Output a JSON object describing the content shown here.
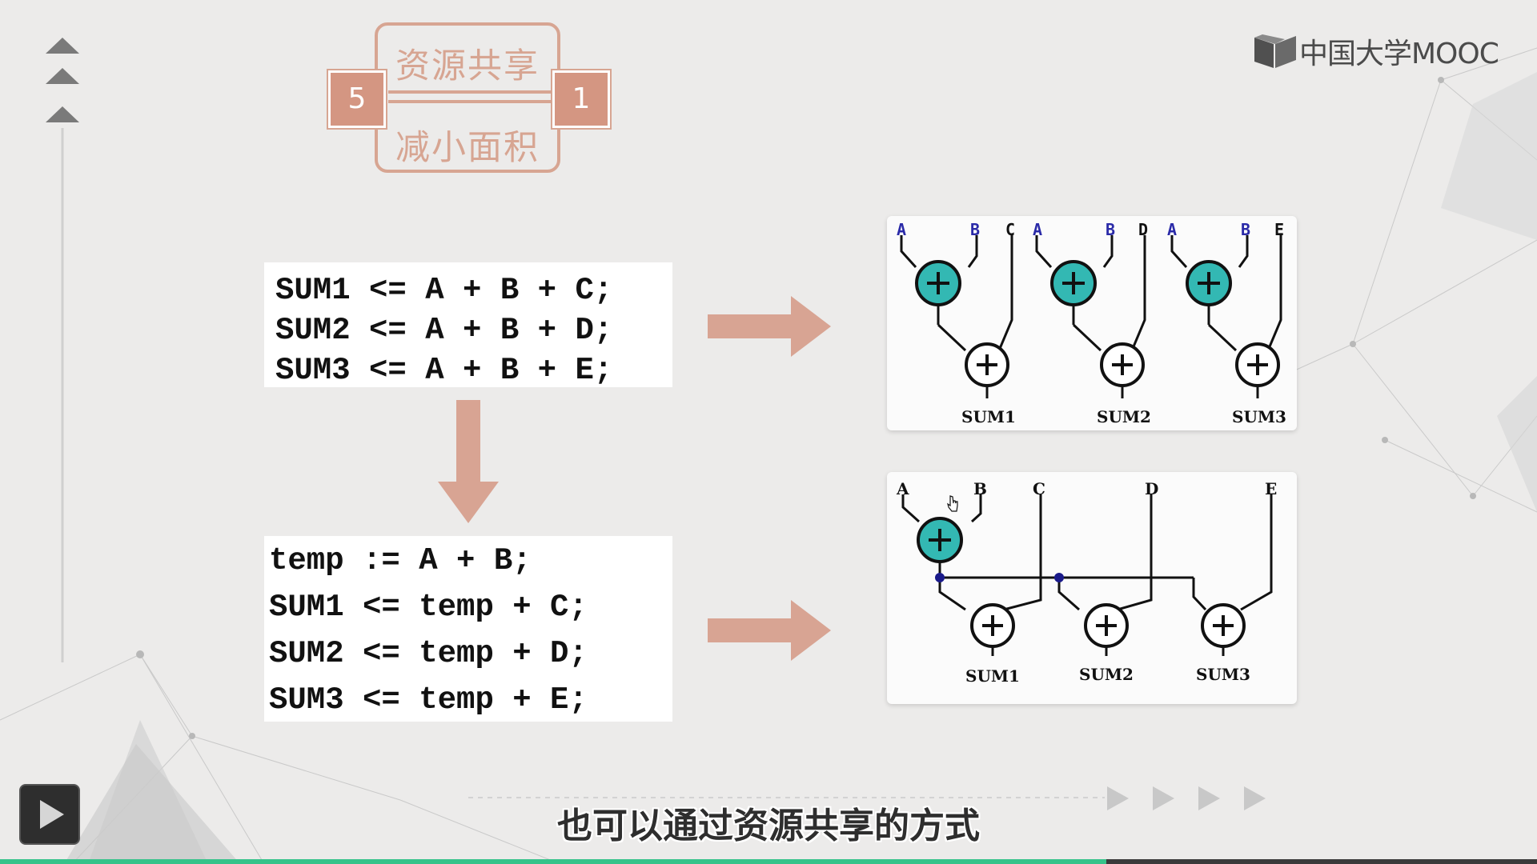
{
  "slide": {
    "title_top": "资源共享",
    "title_bottom": "减小面积",
    "badge_left": "5",
    "badge_right": "1"
  },
  "code_before": {
    "lines": [
      "SUM1 <= A + B + C;",
      "SUM2 <= A + B + D;",
      "SUM3 <= A + B + E;"
    ]
  },
  "code_after": {
    "lines": [
      "temp := A + B;",
      "SUM1 <= temp + C;",
      "SUM2 <= temp + D;",
      "SUM3 <= temp + E;"
    ]
  },
  "circuit_before": {
    "inputs": [
      "A",
      "B",
      "C",
      "A",
      "B",
      "D",
      "A",
      "B",
      "E"
    ],
    "outputs": [
      "SUM1",
      "SUM2",
      "SUM3"
    ]
  },
  "circuit_after": {
    "inputs": [
      "A",
      "B",
      "C",
      "D",
      "E"
    ],
    "outputs": [
      "SUM1",
      "SUM2",
      "SUM3"
    ]
  },
  "logo": {
    "text": "中国大学MOOC",
    "icon": "book-icon"
  },
  "subtitle": "也可以通过资源共享的方式",
  "player": {
    "progress": 0.72,
    "play_icon": "play-icon"
  },
  "colors": {
    "accent": "#d49682",
    "arrow": "#d8a493",
    "adder_highlight": "#33b8b3",
    "progress": "#36c38a"
  }
}
